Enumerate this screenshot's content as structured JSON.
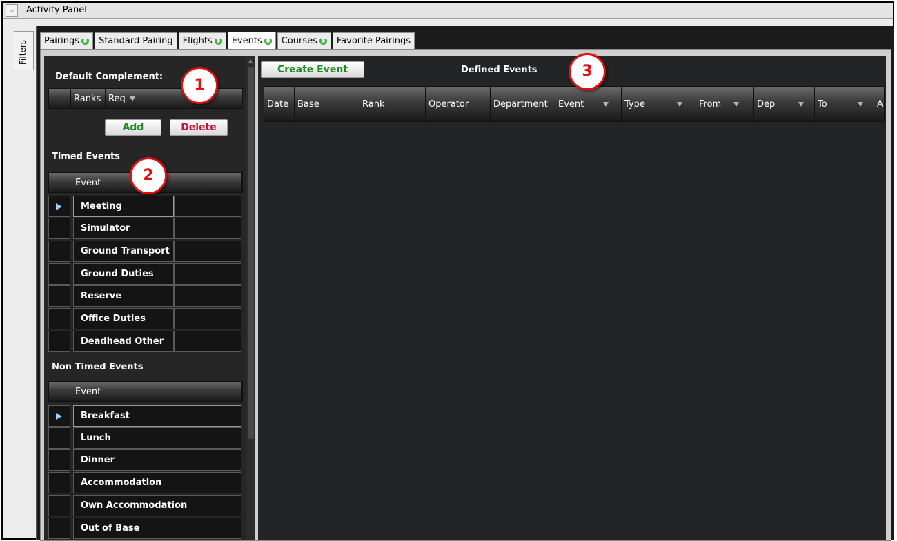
{
  "window": {
    "title": "Activity Panel",
    "collapse_glyph": "⌵"
  },
  "filters_tab": {
    "label": "Filters"
  },
  "tabs": [
    {
      "label": "Pairings",
      "refresh": true,
      "active": false
    },
    {
      "label": "Standard Pairing",
      "refresh": false,
      "active": false
    },
    {
      "label": "Flights",
      "refresh": true,
      "active": false
    },
    {
      "label": "Events",
      "refresh": true,
      "active": true
    },
    {
      "label": "Courses",
      "refresh": true,
      "active": false
    },
    {
      "label": "Favorite Pairings",
      "refresh": false,
      "active": false
    }
  ],
  "default_complement": {
    "label": "Default Complement:",
    "columns": [
      "Ranks",
      "Req"
    ],
    "add_label": "Add",
    "delete_label": "Delete"
  },
  "timed_events": {
    "label": "Timed Events",
    "column": "Event",
    "rows": [
      "Meeting",
      "Simulator",
      "Ground Transport",
      "Ground Duties",
      "Reserve",
      "Office Duties",
      "Deadhead Other"
    ]
  },
  "non_timed_events": {
    "label": "Non Timed Events",
    "column": "Event",
    "rows": [
      "Breakfast",
      "Lunch",
      "Dinner",
      "Accommodation",
      "Own Accommodation",
      "Out of Base"
    ]
  },
  "defined_events": {
    "create_label": "Create Event",
    "title": "Defined Events",
    "columns": [
      "Date",
      "Base",
      "Rank",
      "Operator",
      "Department",
      "Event",
      "Type",
      "From",
      "Dep",
      "To",
      "A"
    ]
  },
  "callouts": [
    "1",
    "2",
    "3"
  ],
  "colors": {
    "add": "#1f8a1f",
    "delete": "#c0163a",
    "create": "#1f8a1f",
    "callout": "#e01010",
    "refresh": "#3bb43b"
  }
}
